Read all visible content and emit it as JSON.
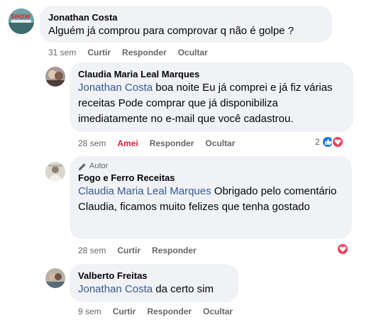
{
  "comments": [
    {
      "author": "Jonathan Costa",
      "text": "Alguém já comprou para comprovar q não é golpe ?",
      "time": "31 sem",
      "actions": [
        "Curtir",
        "Responder",
        "Ocultar"
      ]
    },
    {
      "author": "Claudia Maria Leal Marques",
      "mention": "Jonathan Costa",
      "text": " boa noite Eu já comprei e já fiz várias receitas Pode comprar que já disponibiliza imediatamente no e-mail que você cadastrou.",
      "time": "28 sem",
      "actions": [
        "Amei",
        "Responder",
        "Ocultar"
      ],
      "reaction_count": "2"
    },
    {
      "badge": "Autor",
      "author": "Fogo e Ferro Receitas",
      "mention": "Claudia Maria Leal Marques",
      "text": " Obrigado pelo comentário Claudia, ficamos muito felizes que tenha gostado",
      "time": "28 sem",
      "actions": [
        "Curtir",
        "Responder"
      ]
    },
    {
      "author": "Valberto Freitas",
      "mention": "Jonathan Costa",
      "text": " da certo sim",
      "time": "9 sem",
      "actions": [
        "Curtir",
        "Responder",
        "Ocultar"
      ]
    }
  ],
  "colors": {
    "mention": "#385898",
    "love": "#e41e3f",
    "like": "#1877f2",
    "bubble": "#f0f2f5"
  },
  "icons": [
    "pencil-icon",
    "like-reaction-icon",
    "love-reaction-icon"
  ]
}
